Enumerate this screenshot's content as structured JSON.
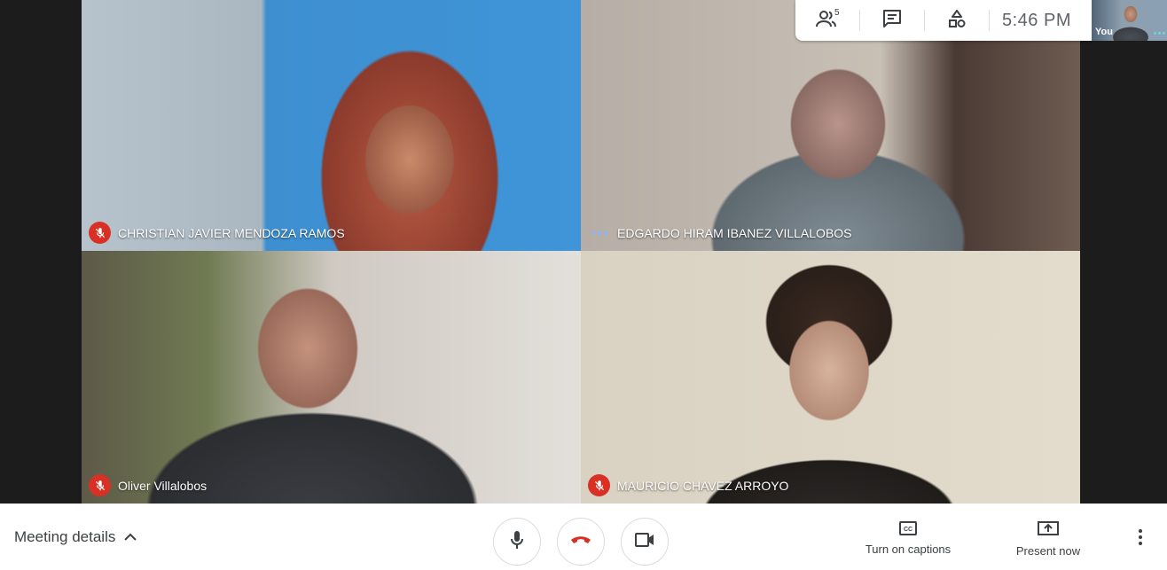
{
  "participants": [
    {
      "name": "CHRISTIAN JAVIER MENDOZA RAMOS",
      "status": "muted"
    },
    {
      "name": "EDGARDO HIRAM IBANEZ VILLALOBOS",
      "status": "speaking"
    },
    {
      "name": "Oliver Villalobos",
      "status": "muted"
    },
    {
      "name": "MAURICIO CHAVEZ ARROYO",
      "status": "muted"
    }
  ],
  "topbar": {
    "people_icon": "people-icon",
    "people_count": "5",
    "chat_icon": "chat-icon",
    "activities_icon": "activities-icon",
    "time": "5:46  PM"
  },
  "self_view": {
    "label": "You"
  },
  "bottombar": {
    "meeting_details": "Meeting details",
    "captions_label": "Turn on captions",
    "present_label": "Present now"
  },
  "colors": {
    "muted_red": "#d93025",
    "hangup_red": "#d93025",
    "speaking_blue": "#8ab4f8"
  }
}
